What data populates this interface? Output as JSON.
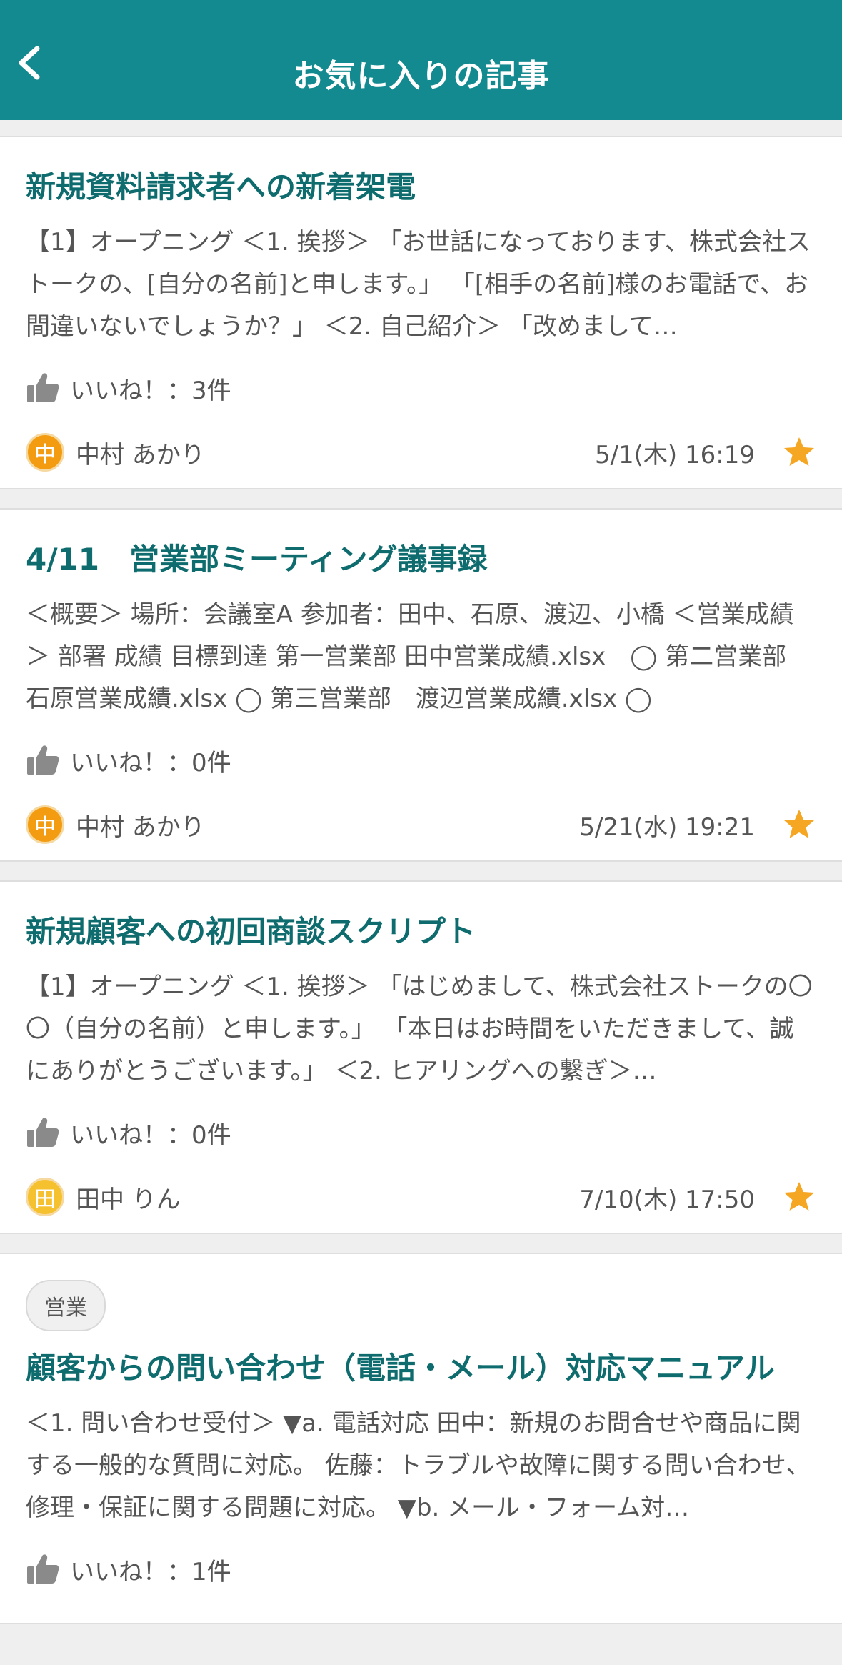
{
  "header": {
    "title": "お気に入りの記事"
  },
  "like_label": "いいね！：",
  "colors": {
    "header_bg": "#138a8f",
    "title_text": "#0f6c6e",
    "star": "#f5a623"
  },
  "articles": [
    {
      "tag": "",
      "title": "新規資料請求者への新着架電",
      "excerpt": "【1】オープニング ＜1. 挨拶＞ 「お世話になっております、株式会社ストークの、[自分の名前]と申します。」 「[相手の名前]様のお電話で、お間違いないでしょうか？」 ＜2. 自己紹介＞ 「改めまして…",
      "likes": "3件",
      "author_initial": "中",
      "avatar_color": "#f39c12",
      "author": "中村 あかり",
      "date": "5/1(木) 16:19"
    },
    {
      "tag": "",
      "title": "4/11　営業部ミーティング議事録",
      "excerpt": "＜概要＞ 場所：会議室A 参加者：田中、石原、渡辺、小橋 ＜営業成績＞ 部署 成績 目標到達 第一営業部 田中営業成績.xlsx　◯ 第二営業部 石原営業成績.xlsx ◯ 第三営業部　渡辺営業成績.xlsx ◯",
      "likes": "0件",
      "author_initial": "中",
      "avatar_color": "#f39c12",
      "author": "中村 あかり",
      "date": "5/21(水) 19:21"
    },
    {
      "tag": "",
      "title": "新規顧客への初回商談スクリプト",
      "excerpt": "【1】オープニング ＜1. 挨拶＞ 「はじめまして、株式会社ストークの〇〇（自分の名前）と申します。」 「本日はお時間をいただきまして、誠にありがとうございます。」 ＜2. ヒアリングへの繋ぎ＞…",
      "likes": "0件",
      "author_initial": "田",
      "avatar_color": "#f6c12f",
      "author": "田中 りん",
      "date": "7/10(木) 17:50"
    },
    {
      "tag": "営業",
      "title": "顧客からの問い合わせ（電話・メール）対応マニュアル",
      "excerpt": "＜1. 問い合わせ受付＞ ▼a. 電話対応 田中：新規のお問合せや商品に関する一般的な質問に対応。 佐藤：トラブルや故障に関する問い合わせ、修理・保証に関する問題に対応。 ▼b. メール・フォーム対…",
      "likes": "1件",
      "author_initial": "",
      "avatar_color": "",
      "author": "",
      "date": ""
    }
  ]
}
